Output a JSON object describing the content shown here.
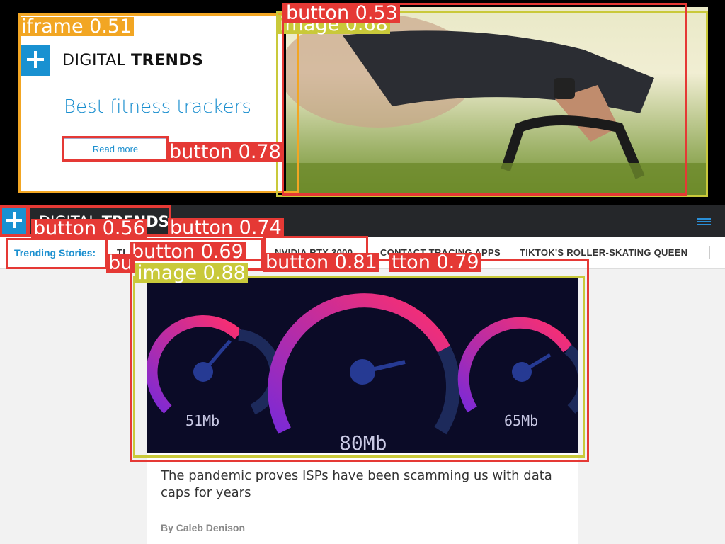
{
  "ad": {
    "logo_light": "DIGITAL",
    "logo_bold": "TRENDS",
    "title": "Best fitness trackers",
    "button_label": "Read more"
  },
  "nav": {
    "logo_light": "DIGITAL",
    "logo_bold": "TRENDS"
  },
  "trending": {
    "label": "Trending Stories:",
    "items": [
      "TI",
      "NVIDIA RTX 3000",
      "CONTACT-TRACING APPS",
      "TIKTOK'S ROLLER-SKATING QUEEN"
    ]
  },
  "article": {
    "gauges": [
      {
        "value_label": "51Mb",
        "ticks": [
          "0",
          "2",
          "5",
          "10",
          "25",
          "50",
          "75",
          "150",
          "300"
        ]
      },
      {
        "value_label": "80Mb",
        "ticks": [
          "0",
          "2",
          "5",
          "10",
          "25",
          "50",
          "75",
          "150",
          "300"
        ]
      },
      {
        "value_label": "65Mb",
        "ticks": [
          "0",
          "2",
          "5",
          "10",
          "25",
          "50",
          "75",
          "150",
          "300"
        ]
      }
    ],
    "headline": "The pandemic proves ISPs have been scamming us with data caps for years",
    "byline": "By Caleb Denison"
  },
  "detections": [
    {
      "label": "iframe 0.51"
    },
    {
      "label": "image 0.68"
    },
    {
      "label": "button 0.53"
    },
    {
      "label": "button 0.78"
    },
    {
      "label": "button 0.56"
    },
    {
      "label": "button 0.74"
    },
    {
      "label": "button 0.69"
    },
    {
      "label": "bu"
    },
    {
      "label": "button 0.81"
    },
    {
      "label": "tton 0.79"
    },
    {
      "label": "image 0.88"
    }
  ],
  "colors": {
    "brand_blue": "#1991d1",
    "nav_dark": "#25272a",
    "det_red": "#e53935",
    "det_olive": "#c9c93a",
    "det_orange": "#f2a623"
  }
}
